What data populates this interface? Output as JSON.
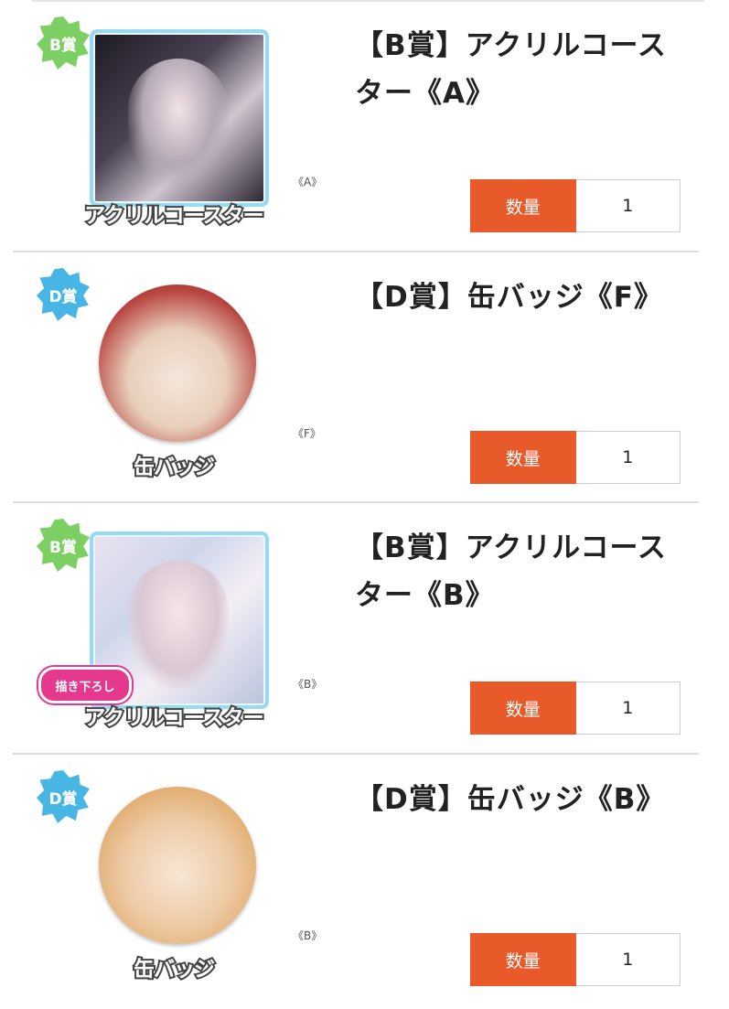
{
  "quantity_label": "数量",
  "items": [
    {
      "badge": "B賞",
      "title": "【B賞】アクリルコースター《A》",
      "caption": "アクリルコースター",
      "variant": "《A》",
      "quantity": "1",
      "extra_tag": ""
    },
    {
      "badge": "D賞",
      "title": "【D賞】缶バッジ《F》",
      "caption": "缶バッジ",
      "variant": "《F》",
      "quantity": "1",
      "extra_tag": ""
    },
    {
      "badge": "B賞",
      "title": "【B賞】アクリルコースター《B》",
      "caption": "アクリルコースター",
      "variant": "《B》",
      "quantity": "1",
      "extra_tag": "描き下ろし"
    },
    {
      "badge": "D賞",
      "title": "【D賞】缶バッジ《B》",
      "caption": "缶バッジ",
      "variant": "《B》",
      "quantity": "1",
      "extra_tag": ""
    }
  ],
  "colors": {
    "accent": "#e85a2a",
    "badge_b": "#7ccf63",
    "badge_d": "#48b6e5",
    "tag_pink": "#e4398c"
  }
}
